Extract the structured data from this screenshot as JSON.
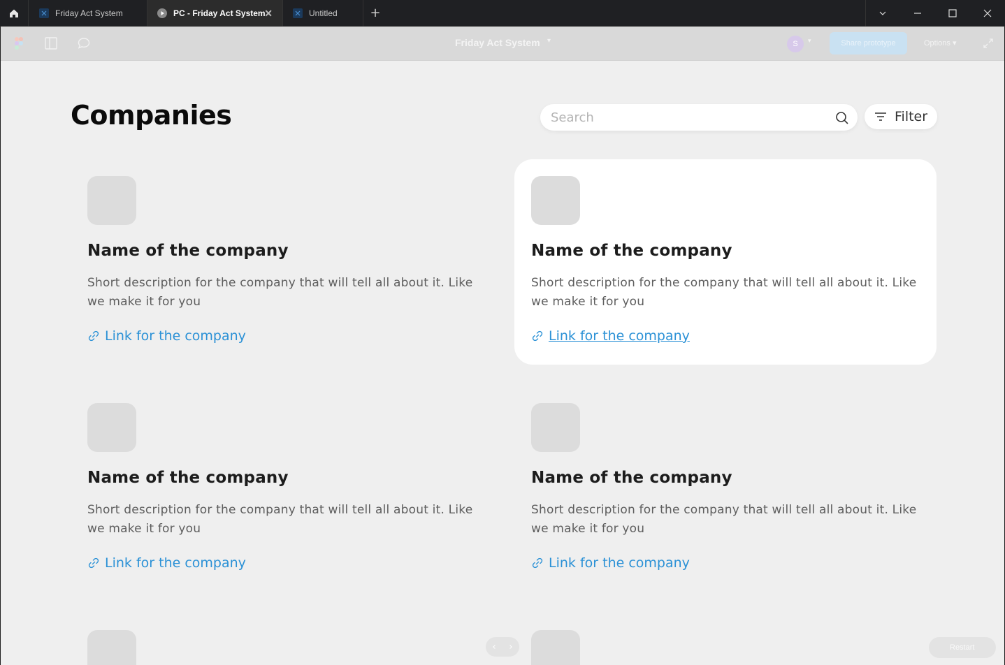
{
  "window": {
    "tabs": [
      {
        "label": "Friday Act System",
        "active": false
      },
      {
        "label": "PC - Friday Act System",
        "active": true
      },
      {
        "label": "Untitled",
        "active": false
      }
    ],
    "new_tab": "+"
  },
  "toolbar": {
    "file_name": "Friday Act System",
    "avatar_initial": "S",
    "share_label": "Share prototype",
    "options_label": "Options"
  },
  "page": {
    "title": "Companies",
    "search_placeholder": "Search",
    "filter_label": "Filter"
  },
  "companies": [
    {
      "name": "Name of the company",
      "description": "Short description for the company that will tell all about it. Like we make it for you",
      "link": "Link for the company"
    },
    {
      "name": "Name of the company",
      "description": "Short description for the company that will tell all about it. Like we make it for you",
      "link": "Link for the company",
      "highlighted": true
    },
    {
      "name": "Name of the company",
      "description": "Short description for the company that will tell all about it. Like we make it for you",
      "link": "Link for the company"
    },
    {
      "name": "Name of the company",
      "description": "Short description for the company that will tell all about it. Like we make it for you",
      "link": "Link for the company"
    }
  ],
  "footer": {
    "restart_label": "Restart"
  },
  "colors": {
    "link": "#2b91d6",
    "canvas": "#efefef",
    "titlebar": "#1f2023"
  }
}
